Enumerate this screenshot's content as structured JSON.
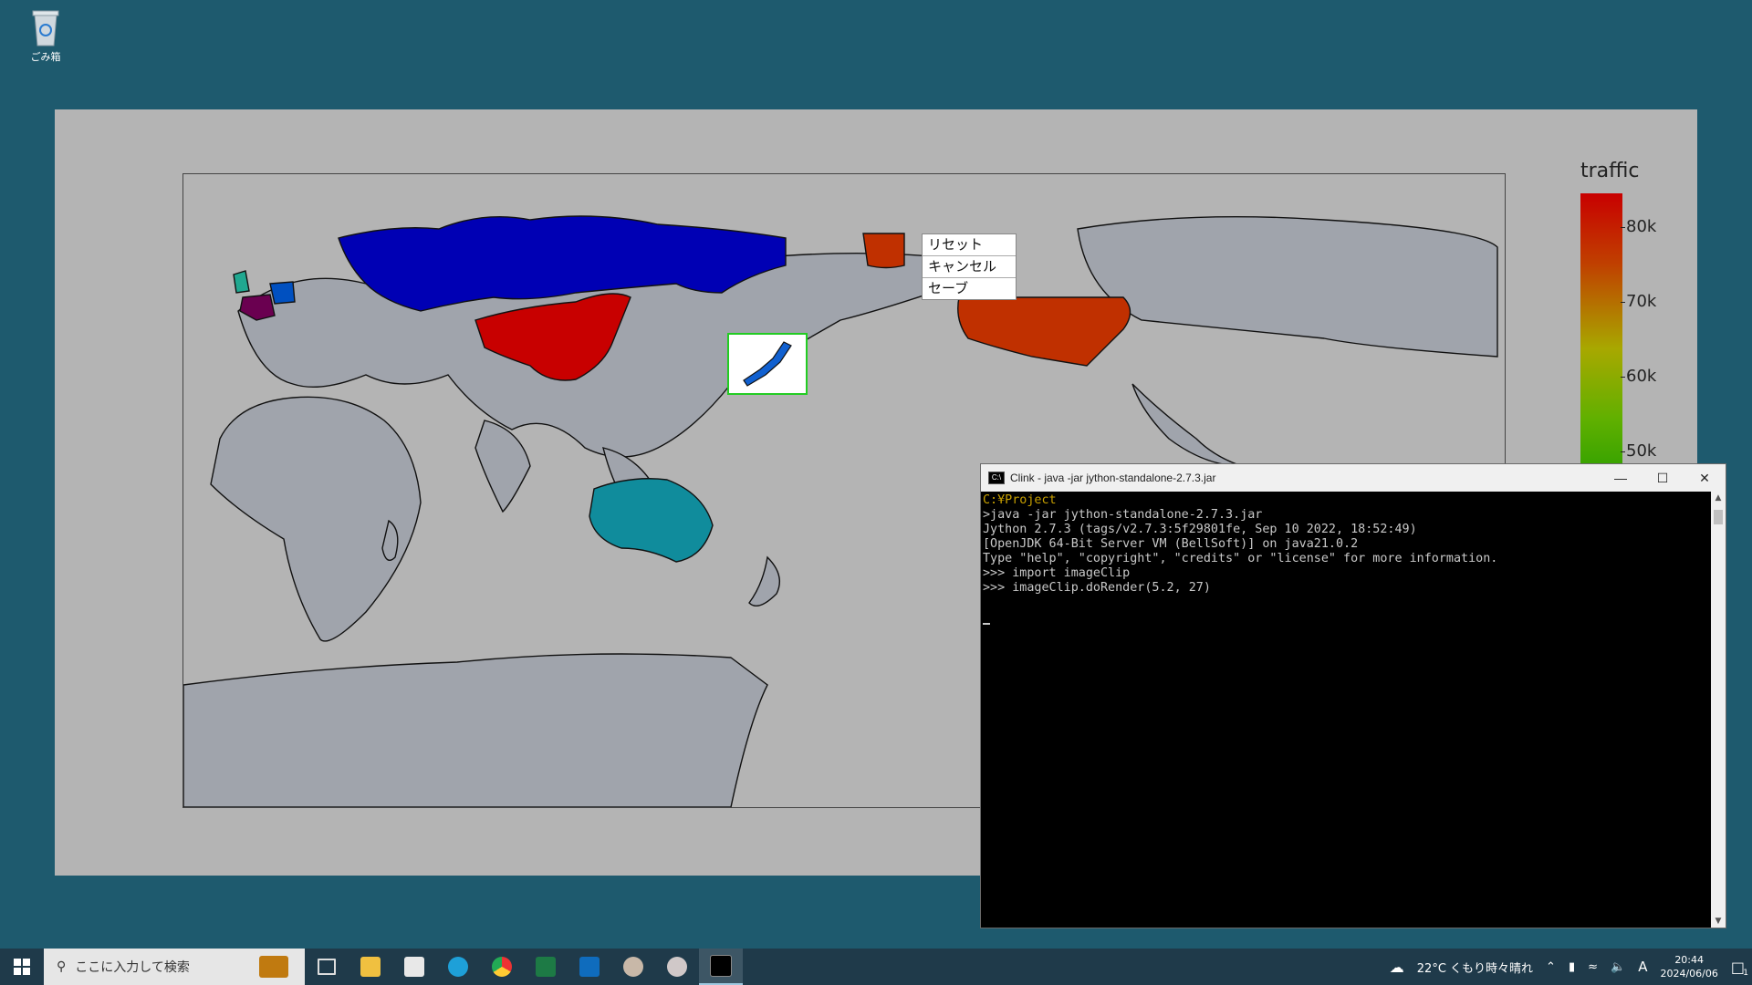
{
  "desktop": {
    "recycle_bin_label": "ごみ箱"
  },
  "chart_window": {
    "colorbar_title": "traffic",
    "colorbar_ticks": [
      "80k",
      "70k",
      "60k",
      "50k"
    ],
    "context_menu": [
      "リセット",
      "キャンセル",
      "セーブ"
    ]
  },
  "chart_data": {
    "type": "heatmap",
    "title": "",
    "colorbar_title": "traffic",
    "colorbar_ticks": [
      "80k",
      "70k",
      "60k",
      "50k"
    ],
    "regions": [
      {
        "name": "Russia",
        "color": "#0000b4"
      },
      {
        "name": "China",
        "color": "#c80000"
      },
      {
        "name": "United States",
        "color": "#c03000"
      },
      {
        "name": "Alaska",
        "color": "#c03000"
      },
      {
        "name": "Australia",
        "color": "#108c9c"
      },
      {
        "name": "France",
        "color": "#6a0050"
      },
      {
        "name": "United Kingdom",
        "color": "#20a890"
      },
      {
        "name": "Germany",
        "color": "#0050c0"
      },
      {
        "name": "Japan",
        "color": "#1060d0"
      }
    ]
  },
  "console": {
    "title": "Clink - java  -jar jython-standalone-2.7.3.jar",
    "lines": [
      "C:¥Project",
      ">java -jar jython-standalone-2.7.3.jar",
      "Jython 2.7.3 (tags/v2.7.3:5f29801fe, Sep 10 2022, 18:52:49)",
      "[OpenJDK 64-Bit Server VM (BellSoft)] on java21.0.2",
      "Type \"help\", \"copyright\", \"credits\" or \"license\" for more information.",
      ">>> import imageClip",
      ">>> imageClip.doRender(5.2, 27)"
    ]
  },
  "taskbar": {
    "search_placeholder": "ここに入力して検索",
    "weather": "22°C  くもり時々晴れ",
    "time": "20:44",
    "date": "2024/06/06",
    "ime": "A",
    "notif_count": "1"
  }
}
